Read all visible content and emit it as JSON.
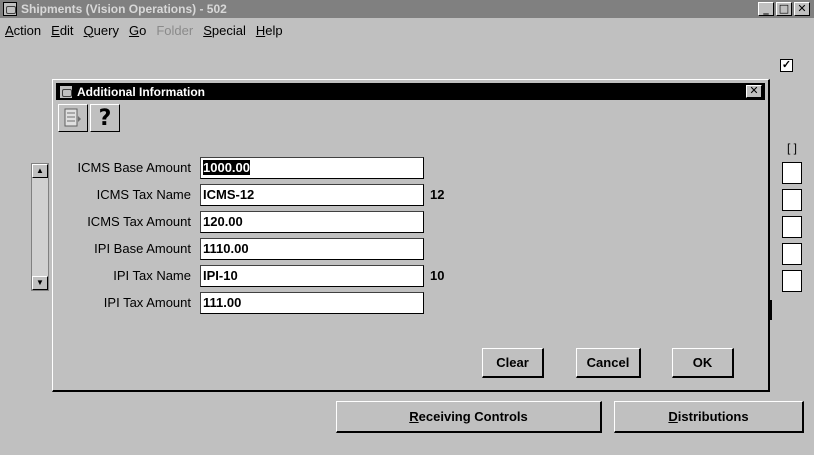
{
  "window": {
    "title": "Shipments (Vision Operations) - 502",
    "buttons": [
      "_",
      "□",
      "✕"
    ]
  },
  "menu": [
    {
      "label": "Action",
      "accel": "A",
      "rest": "ction",
      "enabled": true
    },
    {
      "label": "Edit",
      "accel": "E",
      "rest": "dit",
      "enabled": true
    },
    {
      "label": "Query",
      "accel": "Q",
      "rest": "uery",
      "enabled": true
    },
    {
      "label": "Go",
      "accel": "G",
      "rest": "o",
      "enabled": true
    },
    {
      "label": "Folder",
      "accel": "",
      "rest": "Folder",
      "enabled": false
    },
    {
      "label": "Special",
      "accel": "S",
      "rest": "pecial",
      "enabled": true
    },
    {
      "label": "Help",
      "accel": "H",
      "rest": "elp",
      "enabled": true
    }
  ],
  "outer": {
    "checkbox_mark": "✓",
    "bracket_label": "[ ]",
    "scroll_up": "▲",
    "scroll_down": "▼",
    "receiving_controls": {
      "accel": "R",
      "rest": "eceiving Controls"
    },
    "distributions": {
      "accel": "D",
      "rest": "istributions"
    }
  },
  "dialog": {
    "title": "Additional Information",
    "close": "✕",
    "help_glyph": "?",
    "fields": [
      {
        "label": "ICMS Base Amount",
        "value": "1000.00",
        "extra": "",
        "selected": true
      },
      {
        "label": "ICMS Tax Name",
        "value": "ICMS-12",
        "extra": "12",
        "selected": false
      },
      {
        "label": "ICMS Tax Amount",
        "value": "120.00",
        "extra": "",
        "selected": false
      },
      {
        "label": "IPI Base Amount",
        "value": "1110.00",
        "extra": "",
        "selected": false
      },
      {
        "label": "IPI Tax Name",
        "value": "IPI-10",
        "extra": "10",
        "selected": false
      },
      {
        "label": "IPI Tax Amount",
        "value": "111.00",
        "extra": "",
        "selected": false
      }
    ],
    "buttons": {
      "clear": "Clear",
      "cancel": "Cancel",
      "ok": "OK"
    }
  }
}
